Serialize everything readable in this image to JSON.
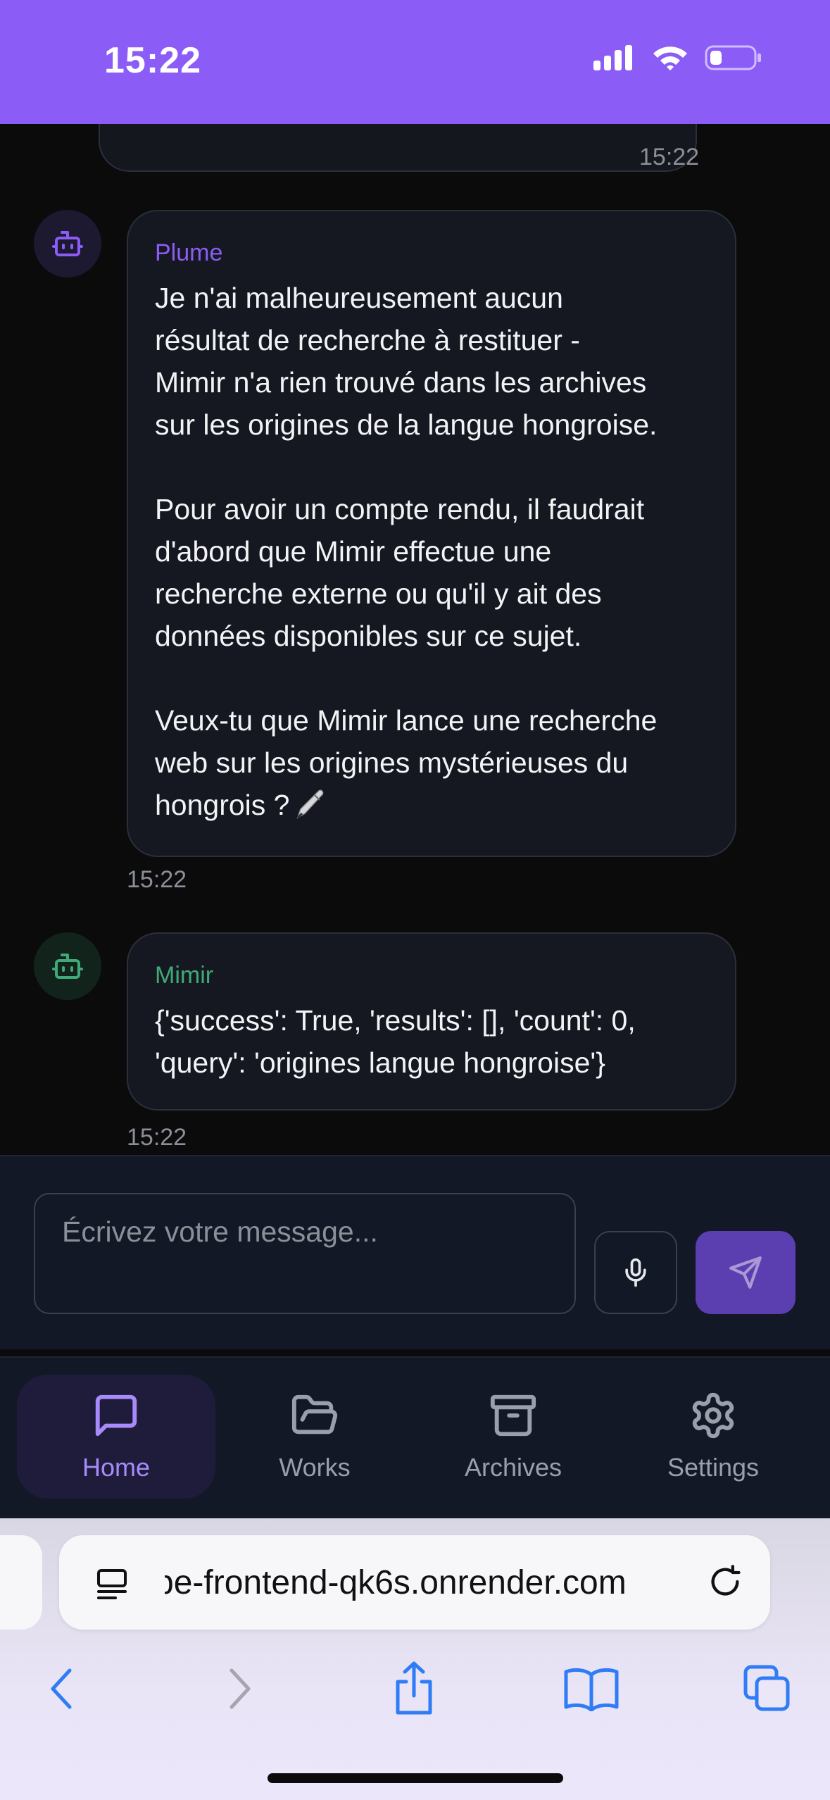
{
  "status_bar": {
    "time": "15:22"
  },
  "chat": {
    "prev_timestamp": "15:22",
    "messages": [
      {
        "sender": "Plume",
        "paragraphs": [
          "Je n'ai malheureusement aucun\nrésultat de recherche à restituer -\nMimir n'a rien trouvé dans les archives\nsur les origines de la langue hongroise.",
          "Pour avoir un compte rendu, il faudrait\nd'abord que Mimir effectue une\nrecherche externe ou qu'il y ait des\ndonnées disponibles sur ce sujet.",
          "Veux-tu que Mimir lance une recherche\nweb sur les origines mystérieuses du\nhongrois ?"
        ],
        "timestamp": "15:22"
      },
      {
        "sender": "Mimir",
        "paragraphs": [
          "{'success': True, 'results': [], 'count': 0,\n'query': 'origines langue hongroise'}"
        ],
        "timestamp": "15:22"
      }
    ]
  },
  "composer": {
    "placeholder": "Écrivez votre message..."
  },
  "nav": {
    "items": [
      {
        "label": "Home",
        "icon": "chat-bubble-icon",
        "active": true
      },
      {
        "label": "Works",
        "icon": "folder-open-icon",
        "active": false
      },
      {
        "label": "Archives",
        "icon": "archive-box-icon",
        "active": false
      },
      {
        "label": "Settings",
        "icon": "gear-icon",
        "active": false
      }
    ]
  },
  "browser": {
    "url": "pe-frontend-qk6s.onrender.com"
  },
  "colors": {
    "accent": "#8b5cf6",
    "mimir": "#3fa97a",
    "background": "#0b0b0c",
    "bubble": "#151821"
  }
}
